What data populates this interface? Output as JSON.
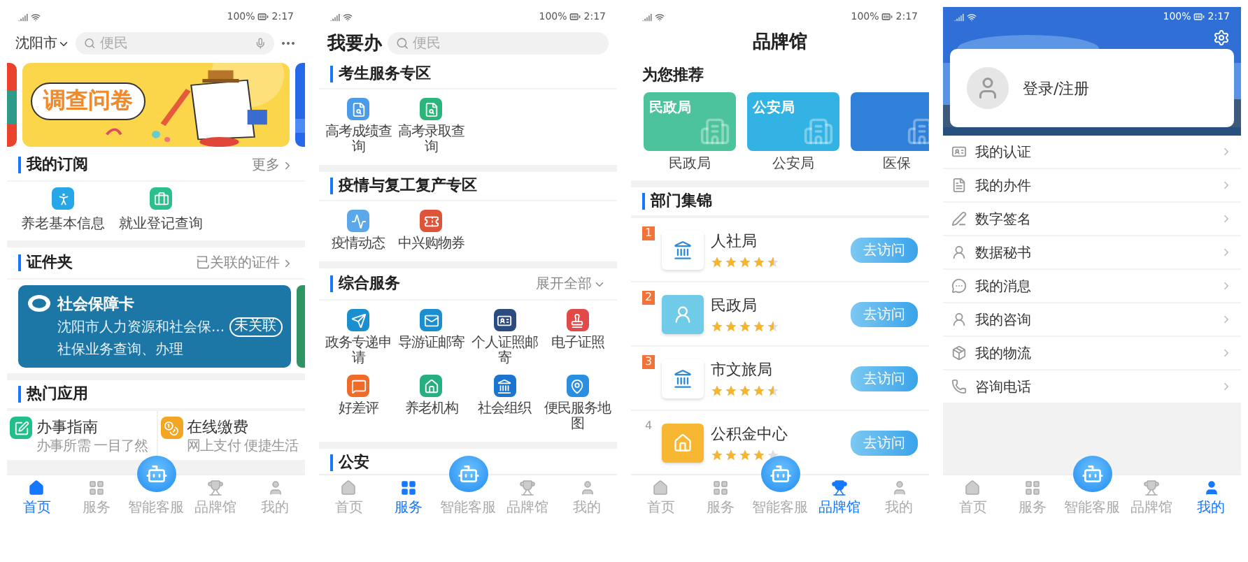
{
  "screens": [
    {
      "kind": "home",
      "status": {
        "battery": "100%",
        "time": "2:17"
      },
      "city": "沈阳市",
      "search": {
        "placeholder": "便民"
      },
      "banner": {
        "title": "调查问卷"
      },
      "subscriptions": {
        "title": "我的订阅",
        "more": "更多",
        "items": [
          "养老基本信息",
          "就业登记查询"
        ]
      },
      "wallet": {
        "title": "证件夹",
        "link": "已关联的证件",
        "card": {
          "name": "社会保障卡",
          "issuer": "沈阳市人力资源和社会保...",
          "action": "未关联",
          "description": "社保业务查询、办理"
        }
      },
      "hot_apps": {
        "title": "热门应用",
        "items": [
          {
            "name": "办事指南",
            "caption": "办事所需 一目了然"
          },
          {
            "name": "在线缴费",
            "caption": "网上支付 便捷生活"
          }
        ]
      },
      "nav": [
        {
          "label": "首页",
          "selected": true
        },
        {
          "label": "服务",
          "selected": false
        },
        {
          "label": "智能客服",
          "selected": false
        },
        {
          "label": "品牌馆",
          "selected": false
        },
        {
          "label": "我的",
          "selected": false
        }
      ]
    },
    {
      "kind": "services",
      "status": {
        "battery": "100%",
        "time": "2:17"
      },
      "title": "我要办",
      "search": {
        "placeholder": "便民"
      },
      "sections": [
        {
          "title": "考生服务专区",
          "items": [
            "高考成绩查询",
            "高考录取查询"
          ]
        },
        {
          "title": "疫情与复工复产专区",
          "items": [
            "疫情动态",
            "中兴购物券"
          ]
        },
        {
          "title": "综合服务",
          "more": "展开全部",
          "items": [
            "政务专递申请",
            "导游证邮寄",
            "个人证照邮寄",
            "电子证照",
            "好差评",
            "养老机构",
            "社会组织",
            "便民服务地图"
          ]
        },
        {
          "title": "公安"
        }
      ],
      "nav": [
        {
          "label": "首页",
          "selected": false
        },
        {
          "label": "服务",
          "selected": true
        },
        {
          "label": "智能客服",
          "selected": false
        },
        {
          "label": "品牌馆",
          "selected": false
        },
        {
          "label": "我的",
          "selected": false
        }
      ]
    },
    {
      "kind": "brands",
      "status": {
        "battery": "100%",
        "time": "2:17"
      },
      "title": "品牌馆",
      "recommend": {
        "title": "为您推荐",
        "cards": [
          {
            "badge": "民政局",
            "label": "民政局",
            "color": "#4cc39c"
          },
          {
            "badge": "公安局",
            "label": "公安局",
            "color": "#33b3e3"
          },
          {
            "label": "医保",
            "color": "#2f80d9"
          }
        ]
      },
      "departments": {
        "title": "部门集锦",
        "rows": [
          {
            "rank": "1",
            "top": true,
            "name": "人社局",
            "stars": 4.5,
            "action": "去访问"
          },
          {
            "rank": "2",
            "top": true,
            "name": "民政局",
            "stars": 4.5,
            "action": "去访问"
          },
          {
            "rank": "3",
            "top": true,
            "name": "市文旅局",
            "stars": 4.5,
            "action": "去访问"
          },
          {
            "rank": "4",
            "top": false,
            "name": "公积金中心",
            "stars": 4,
            "action": "去访问"
          }
        ]
      },
      "nav": [
        {
          "label": "首页",
          "selected": false
        },
        {
          "label": "服务",
          "selected": false
        },
        {
          "label": "智能客服",
          "selected": false
        },
        {
          "label": "品牌馆",
          "selected": true
        },
        {
          "label": "我的",
          "selected": false
        }
      ]
    },
    {
      "kind": "profile",
      "status": {
        "battery": "100%",
        "time": "2:17"
      },
      "login": "登录/注册",
      "menu": [
        "我的认证",
        "我的办件",
        "数字签名",
        "数据秘书",
        "我的消息",
        "我的咨询",
        "我的物流",
        "咨询电话"
      ],
      "nav": [
        {
          "label": "首页",
          "selected": false
        },
        {
          "label": "服务",
          "selected": false
        },
        {
          "label": "智能客服",
          "selected": false
        },
        {
          "label": "品牌馆",
          "selected": false
        },
        {
          "label": "我的",
          "selected": true
        }
      ]
    }
  ]
}
